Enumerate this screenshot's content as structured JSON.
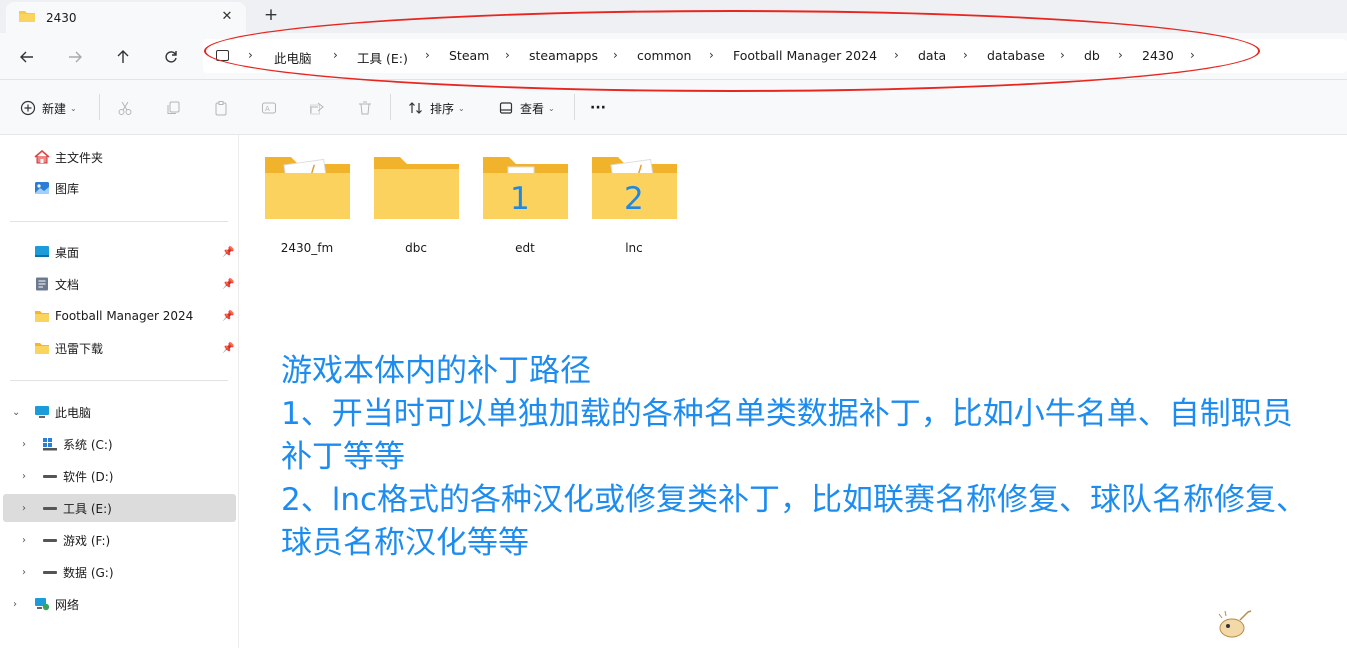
{
  "window": {
    "tab_title": "2430",
    "tab_close": "✕",
    "new_tab": "+"
  },
  "nav": {
    "back": "back",
    "forward": "forward",
    "up": "up",
    "refresh": "refresh"
  },
  "breadcrumbs": [
    "此电脑",
    "工具 (E:)",
    "Steam",
    "steamapps",
    "common",
    "Football Manager 2024",
    "data",
    "database",
    "db",
    "2430"
  ],
  "toolbar": {
    "new_label": "新建",
    "sort_label": "排序",
    "view_label": "查看",
    "more_label": "···"
  },
  "sidebar": {
    "quick": [
      {
        "label": "主文件夹",
        "icon": "home-icon"
      },
      {
        "label": "图库",
        "icon": "gallery-icon"
      }
    ],
    "pinned": [
      {
        "label": "桌面",
        "icon": "desktop-icon"
      },
      {
        "label": "文档",
        "icon": "document-icon"
      },
      {
        "label": "Football Manager 2024",
        "icon": "folder-icon"
      },
      {
        "label": "迅雷下载",
        "icon": "folder-icon"
      }
    ],
    "this_pc": "此电脑",
    "drives": [
      {
        "label": "系统 (C:)",
        "icon": "windows-drive-icon"
      },
      {
        "label": "软件 (D:)",
        "icon": "drive-icon"
      },
      {
        "label": "工具 (E:)",
        "icon": "drive-icon",
        "selected": true
      },
      {
        "label": "游戏 (F:)",
        "icon": "drive-icon"
      },
      {
        "label": "数据 (G:)",
        "icon": "drive-icon"
      }
    ],
    "network": "网络"
  },
  "files": [
    {
      "name": "2430_fm",
      "type": "folder-with-doc",
      "overlay": ""
    },
    {
      "name": "dbc",
      "type": "folder",
      "overlay": ""
    },
    {
      "name": "edt",
      "type": "folder-with-page",
      "overlay": "1"
    },
    {
      "name": "lnc",
      "type": "folder-with-doc",
      "overlay": "2"
    }
  ],
  "annotation": {
    "lines": [
      "游戏本体内的补丁路径",
      "1、开当时可以单独加载的各种名单类数据补丁，比如小牛名单、自制职员",
      "补丁等等",
      "2、lnc格式的各种汉化或修复类补丁，比如联赛名称修复、球队名称修复、",
      "球员名称汉化等等"
    ]
  },
  "colors": {
    "annotation": "#1d8cf0",
    "ellipse": "#e8261f",
    "folder": "#f7c948"
  }
}
